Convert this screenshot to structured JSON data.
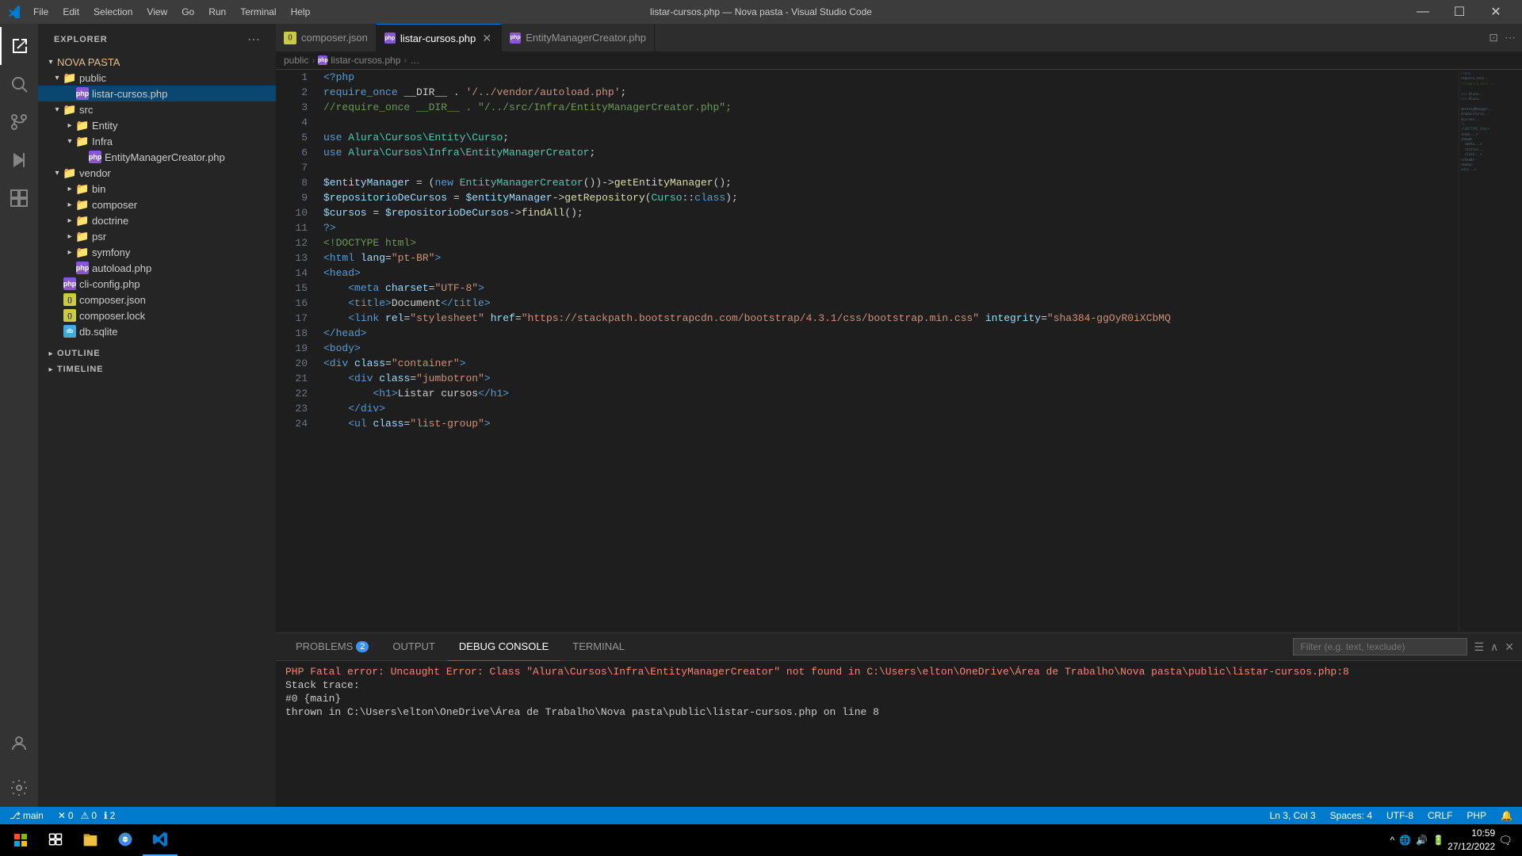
{
  "titlebar": {
    "title": "listar-cursos.php — Nova pasta - Visual Studio Code",
    "menu": [
      "File",
      "Edit",
      "Selection",
      "View",
      "Go",
      "Run",
      "Terminal",
      "Help"
    ],
    "controls": [
      "minimize",
      "maximize",
      "close"
    ]
  },
  "sidebar": {
    "title": "EXPLORER",
    "root_folder": "NOVA PASTA",
    "tree": [
      {
        "id": "public",
        "type": "folder",
        "label": "public",
        "depth": 1,
        "expanded": true
      },
      {
        "id": "listar-cursos-php",
        "type": "file-php",
        "label": "listar-cursos.php",
        "depth": 2,
        "active": true
      },
      {
        "id": "src",
        "type": "folder",
        "label": "src",
        "depth": 1,
        "expanded": true
      },
      {
        "id": "entity",
        "type": "folder",
        "label": "Entity",
        "depth": 2,
        "expanded": false
      },
      {
        "id": "infra",
        "type": "folder",
        "label": "Infra",
        "depth": 2,
        "expanded": true
      },
      {
        "id": "entitymanagercreator-php",
        "type": "file-php",
        "label": "EntityManagerCreator.php",
        "depth": 3
      },
      {
        "id": "vendor",
        "type": "folder",
        "label": "vendor",
        "depth": 1,
        "expanded": true
      },
      {
        "id": "bin",
        "type": "folder",
        "label": "bin",
        "depth": 2,
        "expanded": false
      },
      {
        "id": "composer",
        "type": "folder",
        "label": "composer",
        "depth": 2,
        "expanded": false
      },
      {
        "id": "doctrine",
        "type": "folder",
        "label": "doctrine",
        "depth": 2,
        "expanded": false
      },
      {
        "id": "psr",
        "type": "folder",
        "label": "psr",
        "depth": 2,
        "expanded": false
      },
      {
        "id": "symfony",
        "type": "folder",
        "label": "symfony",
        "depth": 2,
        "expanded": false
      },
      {
        "id": "autoload-php",
        "type": "file-php",
        "label": "autoload.php",
        "depth": 2
      },
      {
        "id": "cli-config-php",
        "type": "file-php",
        "label": "cli-config.php",
        "depth": 1
      },
      {
        "id": "composer-json",
        "type": "file-json",
        "label": "composer.json",
        "depth": 1
      },
      {
        "id": "composer-lock",
        "type": "file-json",
        "label": "composer.lock",
        "depth": 1
      },
      {
        "id": "db-sqlite",
        "type": "file-sqlite",
        "label": "db.sqlite",
        "depth": 1
      }
    ],
    "outline_label": "OUTLINE",
    "timeline_label": "TIMELINE"
  },
  "tabs": [
    {
      "id": "composer-json",
      "label": "composer.json",
      "icon": "json",
      "active": false,
      "closable": false
    },
    {
      "id": "listar-cursos-php",
      "label": "listar-cursos.php",
      "icon": "php",
      "active": true,
      "closable": true
    },
    {
      "id": "entitymanagercreator-php",
      "label": "EntityManagerCreator.php",
      "icon": "php",
      "active": false,
      "closable": false
    }
  ],
  "breadcrumb": [
    "public",
    "listar-cursos.php",
    "…"
  ],
  "code_lines": [
    {
      "n": 1,
      "text": "<?php",
      "tokens": [
        {
          "t": "kw",
          "v": "<?php"
        }
      ]
    },
    {
      "n": 2,
      "text": "require_once __DIR__ . '/../vendor/autoload.php';"
    },
    {
      "n": 3,
      "text": "//require_once __DIR__ . \"/../src/Infra/EntityManagerCreator.php\";"
    },
    {
      "n": 4,
      "text": ""
    },
    {
      "n": 5,
      "text": "use Alura\\Cursos\\Entity\\Curso;"
    },
    {
      "n": 6,
      "text": "use Alura\\Cursos\\Infra\\EntityManagerCreator;"
    },
    {
      "n": 7,
      "text": ""
    },
    {
      "n": 8,
      "text": "$entityManager = (new EntityManagerCreator())->getEntityManager();"
    },
    {
      "n": 9,
      "text": "$repositorioDeCursos = $entityManager->getRepository(Curso::class);"
    },
    {
      "n": 10,
      "text": "$cursos = $repositorioDeCursos->findAll();"
    },
    {
      "n": 11,
      "text": "?>"
    },
    {
      "n": 12,
      "text": "<!DOCTYPE html>"
    },
    {
      "n": 13,
      "text": "<html lang=\"pt-BR\">"
    },
    {
      "n": 14,
      "text": "<head>"
    },
    {
      "n": 15,
      "text": "    <meta charset=\"UTF-8\">"
    },
    {
      "n": 16,
      "text": "    <title>Document</title>"
    },
    {
      "n": 17,
      "text": "    <link rel=\"stylesheet\" href=\"https://stackpath.bootstrapcdn.com/bootstrap/4.3.1/css/bootstrap.min.css\" integrity=\"sha384-ggOyR0iXCbMQ"
    },
    {
      "n": 18,
      "text": "</head>"
    },
    {
      "n": 19,
      "text": "<body>"
    },
    {
      "n": 20,
      "text": "<div class=\"container\">"
    },
    {
      "n": 21,
      "text": "    <div class=\"jumbotron\">"
    },
    {
      "n": 22,
      "text": "        <h1>Listar cursos</h1>"
    },
    {
      "n": 23,
      "text": "    </div>"
    },
    {
      "n": 24,
      "text": "    <ul class=\"list-group\">"
    }
  ],
  "bottom_panel": {
    "tabs": [
      "PROBLEMS",
      "OUTPUT",
      "DEBUG CONSOLE",
      "TERMINAL"
    ],
    "active_tab": "DEBUG CONSOLE",
    "problems_count": 2,
    "filter_placeholder": "Filter (e.g. text, !exclude)",
    "error_lines": [
      "PHP Fatal error:  Uncaught Error: Class \"Alura\\Cursos\\Infra\\EntityManagerCreator\" not found in C:\\Users\\elton\\OneDrive\\Área de Trabalho\\Nova pasta\\public\\listar-cursos.php:8",
      "Stack trace:",
      "#0 {main}",
      "  thrown in C:\\Users\\elton\\OneDrive\\Área de Trabalho\\Nova pasta\\public\\listar-cursos.php on line 8"
    ]
  },
  "status_bar": {
    "errors": "0",
    "warnings": "0",
    "infos": "2",
    "line": "Ln 3, Col 3",
    "spaces": "Spaces: 4",
    "encoding": "UTF-8",
    "eol": "CRLF",
    "language": "PHP"
  },
  "taskbar": {
    "apps": [
      {
        "id": "windows",
        "label": "Start"
      },
      {
        "id": "taskview",
        "label": "Task View"
      },
      {
        "id": "explorer",
        "label": "File Explorer"
      },
      {
        "id": "chrome",
        "label": "Chrome"
      },
      {
        "id": "vscode",
        "label": "VS Code",
        "active": true
      }
    ],
    "clock": "10:59",
    "date": "27/12/2022"
  }
}
